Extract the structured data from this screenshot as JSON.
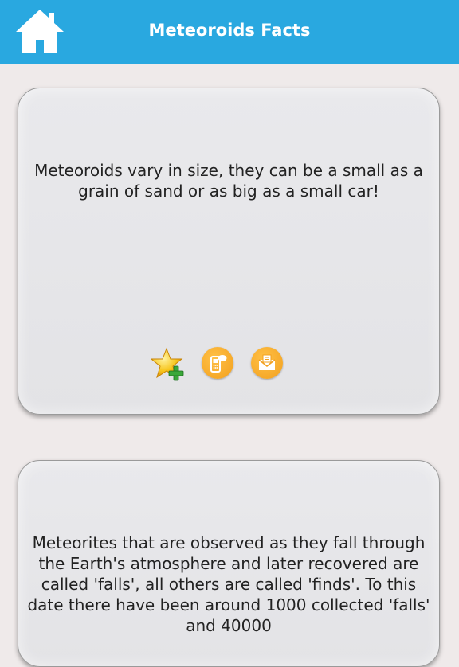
{
  "header": {
    "title": "Meteoroids Facts",
    "home_icon": "home-icon"
  },
  "facts": [
    {
      "text": "Meteoroids vary in size, they can be a small as a grain of sand or as big as a small car!",
      "actions": [
        "add-favorite-icon",
        "sms-phone-icon",
        "email-icon"
      ]
    },
    {
      "text": "Meteorites that are observed as they fall through the Earth's atmosphere and later recovered are called 'falls', all others are called 'finds'. To this date there have been around 1000 collected 'falls' and 40000"
    }
  ],
  "colors": {
    "header_bg": "#29a8e0",
    "page_bg": "#efeaea",
    "action_orange": "#f5a623"
  }
}
